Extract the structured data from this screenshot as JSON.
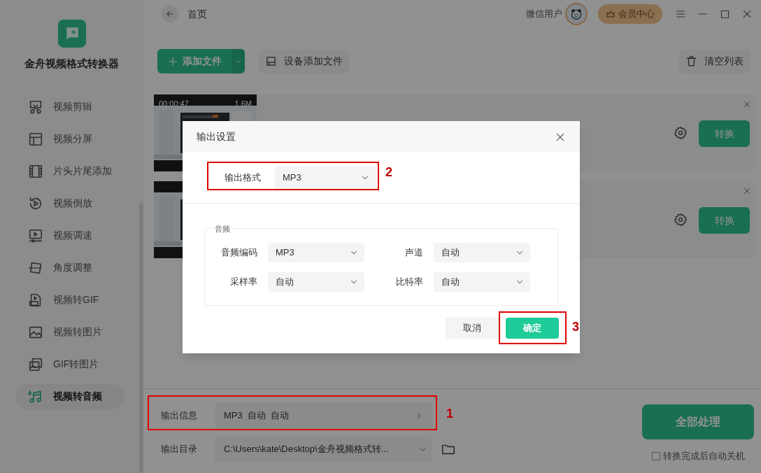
{
  "app": {
    "title": "金舟视频格式转换器"
  },
  "sidebar": {
    "items": [
      {
        "label": "视频剪辑",
        "selected": false
      },
      {
        "label": "视频分屏",
        "selected": false
      },
      {
        "label": "片头片尾添加",
        "selected": false
      },
      {
        "label": "视频倒放",
        "selected": false
      },
      {
        "label": "视频调速",
        "selected": false
      },
      {
        "label": "角度调整",
        "selected": false
      },
      {
        "label": "视频转GIF",
        "selected": false
      },
      {
        "label": "视频转图片",
        "selected": false
      },
      {
        "label": "GIF转图片",
        "selected": false
      },
      {
        "label": "视频转音频",
        "selected": true
      }
    ]
  },
  "header": {
    "breadcrumb": "首页",
    "user": "微信用户",
    "vip": "会员中心"
  },
  "toolbar": {
    "add": "添加文件",
    "device": "设备添加文件",
    "clear": "清空列表"
  },
  "files": [
    {
      "kind": "picture",
      "duration": "00:00:47",
      "size": "1.6M",
      "convert": "转换"
    },
    {
      "kind": "picture",
      "convert": "转换"
    }
  ],
  "output": {
    "info_label": "输出信息",
    "info": "MP3  自动  自动",
    "dir_label": "输出目录",
    "dir": "C:\\Users\\kate\\Desktop\\金舟视频格式转...",
    "process": "全部处理",
    "shutdown": "转换完成后自动关机",
    "shutdown_checked": false
  },
  "dialog": {
    "title": "输出设置",
    "format_label": "输出格式",
    "format": "MP3",
    "group": "音频",
    "fields": [
      {
        "label": "音频编码",
        "value": "MP3"
      },
      {
        "label": "声道",
        "value": "自动"
      },
      {
        "label": "采样率",
        "value": "自动"
      },
      {
        "label": "比特率",
        "value": "自动"
      }
    ],
    "cancel": "取消",
    "ok": "确定"
  },
  "annotations": [
    {
      "number": "1"
    },
    {
      "number": "2"
    },
    {
      "number": "3"
    }
  ]
}
